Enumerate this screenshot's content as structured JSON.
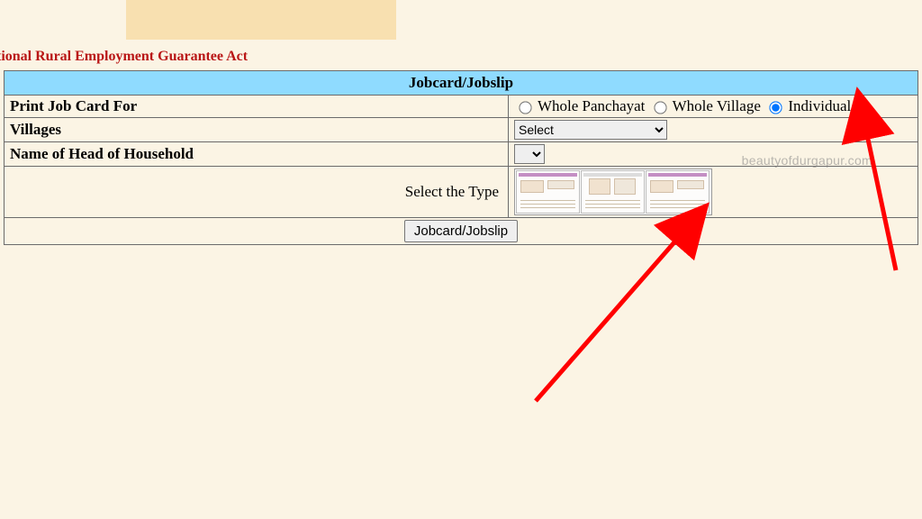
{
  "page": {
    "act_title": "tional Rural Employment Guarantee Act",
    "section_header": "Jobcard/Jobslip"
  },
  "form": {
    "print_for": {
      "label": "Print Job Card For",
      "options": {
        "panchayat": "Whole Panchayat",
        "village": "Whole Village",
        "individual": "Individual"
      },
      "selected": "individual"
    },
    "villages": {
      "label": "Villages",
      "selected": "Select"
    },
    "head": {
      "label": "Name of Head of Household"
    },
    "type_label": "Select the Type",
    "submit_label": "Jobcard/Jobslip"
  },
  "watermark": "beautyofdurgapur.com"
}
